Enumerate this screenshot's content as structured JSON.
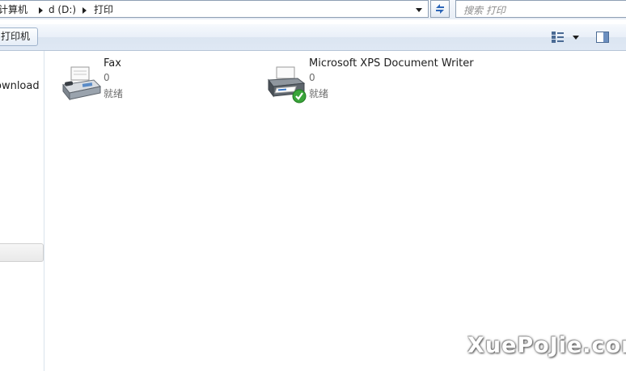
{
  "address_bar": {
    "crumbs": [
      "计算机",
      "d (D:)",
      "打印"
    ]
  },
  "search": {
    "placeholder": "搜索 打印"
  },
  "command_bar": {
    "add_printer_label": "打印机"
  },
  "nav_pane": {
    "item_label": "ownload"
  },
  "printers": [
    {
      "name": "Fax",
      "jobs": "0",
      "status": "就绪",
      "icon": "fax-icon",
      "default": false
    },
    {
      "name": "Microsoft XPS Document Writer",
      "jobs": "0",
      "status": "就绪",
      "icon": "printer-icon",
      "default": true
    }
  ],
  "watermark": "XuePoJie.com",
  "colors": {
    "border": "#8e9fb4",
    "toolbar": "#dfe8f4",
    "default_check": "#3aa53a"
  }
}
